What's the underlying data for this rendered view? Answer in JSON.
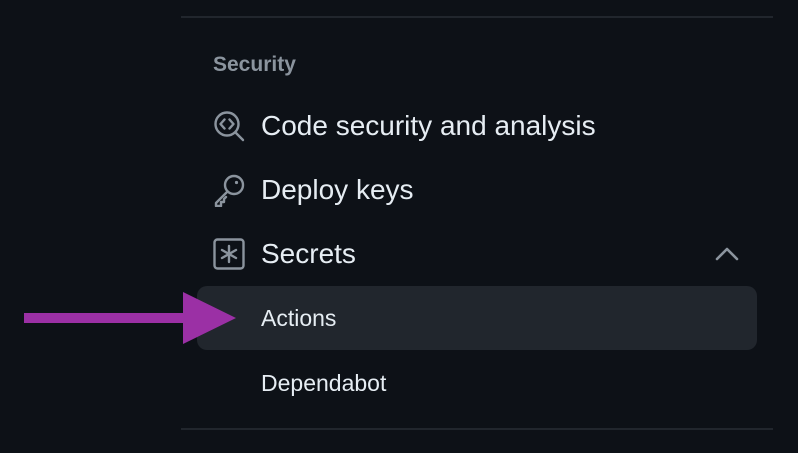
{
  "section": {
    "heading": "Security"
  },
  "nav": {
    "items": [
      {
        "label": "Code security and analysis",
        "icon": "codescan-icon"
      },
      {
        "label": "Deploy keys",
        "icon": "key-icon"
      },
      {
        "label": "Secrets",
        "icon": "asterisk-box-icon",
        "expanded": true
      }
    ],
    "sub_items": [
      {
        "label": "Actions",
        "selected": true
      },
      {
        "label": "Dependabot",
        "selected": false
      }
    ]
  },
  "annotation": {
    "arrow_color": "#9b30a5",
    "points_to": "Actions"
  },
  "colors": {
    "background": "#0d1117",
    "selected_bg": "#21262d",
    "muted_text": "#8b949e",
    "text": "#e6edf3",
    "divider": "#21262d"
  }
}
